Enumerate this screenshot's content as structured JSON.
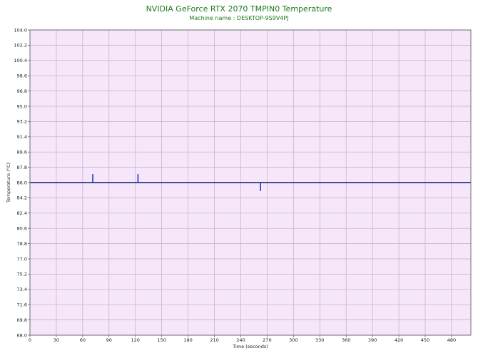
{
  "chart_data": {
    "type": "line",
    "title": "NVIDIA GeForce RTX 2070 TMPIN0 Temperature",
    "subtitle": "Machine name : DESKTOP-9S9V4PJ",
    "xlabel": "Time (seconds)",
    "ylabel": "Temperature (°C)",
    "xlim": [
      0,
      502
    ],
    "ylim": [
      68.0,
      104.0
    ],
    "x_ticks": [
      0,
      30,
      60,
      90,
      120,
      150,
      180,
      210,
      240,
      270,
      300,
      330,
      360,
      390,
      420,
      450,
      480
    ],
    "y_ticks": [
      "68.0",
      "69.8",
      "71.6",
      "73.4",
      "75.2",
      "77.0",
      "78.8",
      "80.6",
      "82.4",
      "84.2",
      "86.0",
      "87.8",
      "89.6",
      "91.4",
      "93.2",
      "95.0",
      "96.8",
      "98.6",
      "100.4",
      "102.2",
      "104.0"
    ],
    "grid": true,
    "background_color": "#f5e6fa",
    "grid_color": "#c8aac8",
    "line_color": "#0a1a6e",
    "spike_color": "#1a3ad0",
    "series": [
      {
        "baseline": 86.0,
        "spikes": [
          {
            "x": 71.5,
            "value": 87.0
          },
          {
            "x": 123.0,
            "value": 87.0
          },
          {
            "x": 262.5,
            "value": 85.0
          }
        ]
      }
    ]
  }
}
